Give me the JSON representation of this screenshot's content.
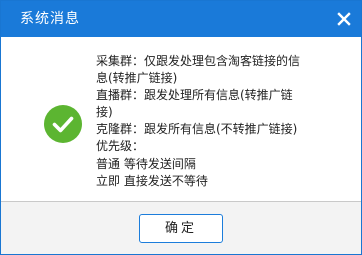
{
  "dialog": {
    "title": "系统消息",
    "close_label": "✕",
    "status_icon": "check-circle-icon",
    "accent_color": "#1a7ad9",
    "success_color": "#5cb531",
    "message_lines": [
      "采集群：仅跟发处理包含淘客链接的信",
      "息(转推广链接)",
      "直播群：跟发处理所有信息(转推广链",
      "接)",
      "克隆群：跟发所有信息(不转推广链接)",
      "优先级：",
      "普通 等待发送间隔",
      "立即 直接发送不等待"
    ],
    "ok_label": "确定"
  }
}
